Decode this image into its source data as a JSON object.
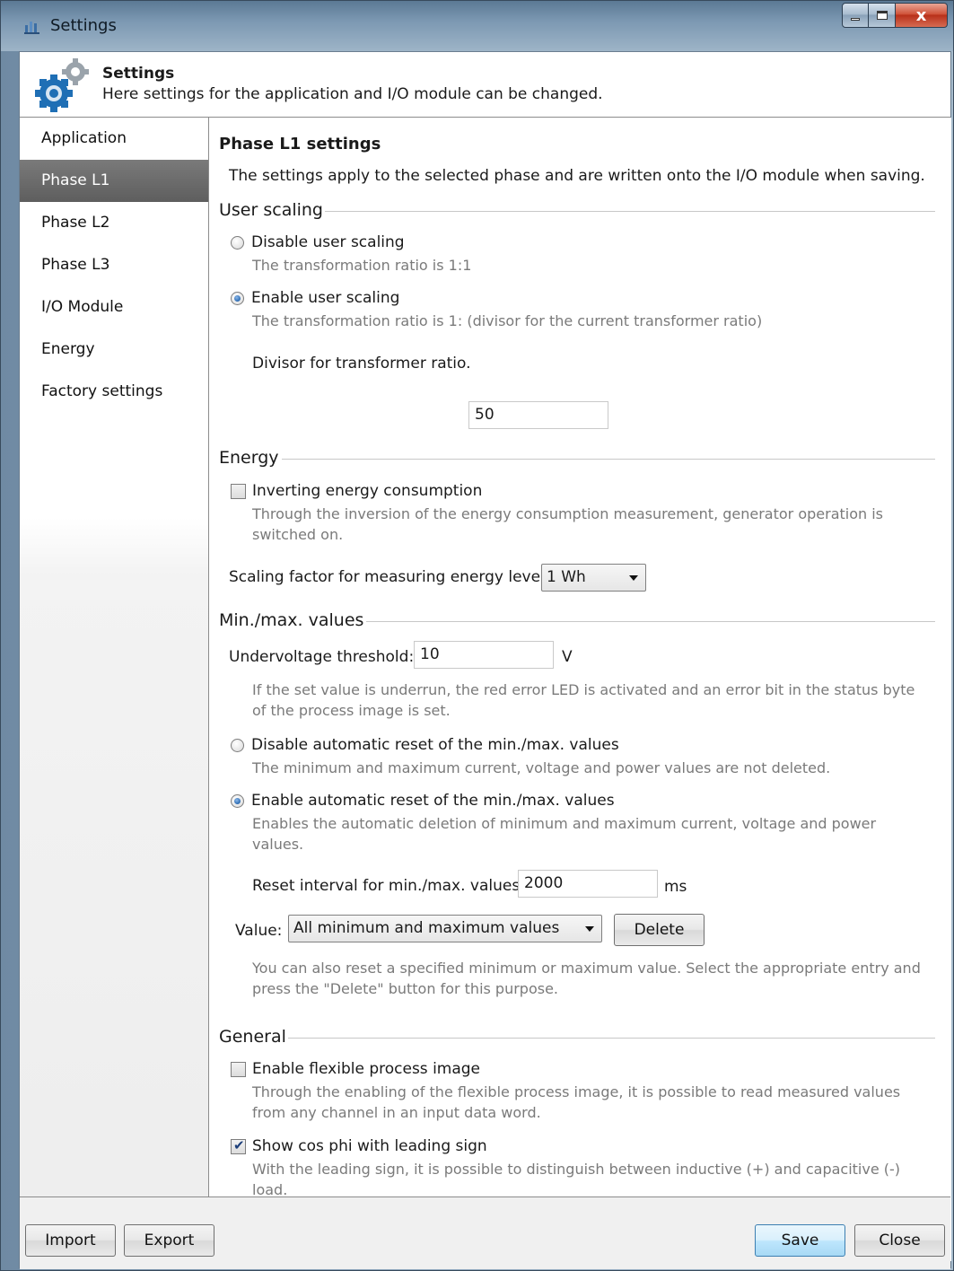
{
  "window": {
    "title": "Settings",
    "minimize_label": "",
    "maximize_label": "",
    "close_label": "x"
  },
  "header": {
    "title": "Settings",
    "subtitle": "Here settings for the application and I/O module can be changed."
  },
  "sidebar": {
    "items": [
      {
        "label": "Application"
      },
      {
        "label": "Phase L1",
        "selected": true
      },
      {
        "label": "Phase L2"
      },
      {
        "label": "Phase L3"
      },
      {
        "label": "I/O Module"
      },
      {
        "label": "Energy"
      },
      {
        "label": "Factory settings"
      }
    ]
  },
  "main": {
    "title": "Phase L1 settings",
    "intro": "The settings apply to the selected phase and are written onto the I/O module when saving.",
    "user_scaling": {
      "title": "User scaling",
      "disable_label": "Disable user scaling",
      "disable_desc": "The transformation ratio is 1:1",
      "disable_checked": false,
      "enable_label": "Enable user scaling",
      "enable_desc": "The transformation ratio is 1: (divisor for the current transformer ratio)",
      "enable_checked": true,
      "divisor_label": "Divisor for transformer ratio.",
      "divisor_value": "50"
    },
    "energy": {
      "title": "Energy",
      "invert_label": "Inverting energy consumption",
      "invert_checked": false,
      "invert_desc": "Through the inversion of the energy consumption measurement, generator operation is switched on.",
      "scaling_label": "Scaling factor for measuring energy level.",
      "scaling_value": "1 Wh"
    },
    "minmax": {
      "title": "Min./max. values",
      "undervoltage_label": "Undervoltage threshold:",
      "undervoltage_value": "10",
      "undervoltage_unit": "V",
      "undervoltage_desc": "If the set value is underrun, the red error LED is activated and an error bit in the status byte of the process image is set.",
      "disable_reset_label": "Disable automatic reset of the min./max. values",
      "disable_reset_desc": "The minimum and maximum current, voltage and power values are not deleted.",
      "disable_reset_checked": false,
      "enable_reset_label": "Enable automatic reset of the min./max. values",
      "enable_reset_desc": "Enables the automatic deletion of minimum and maximum current, voltage and power values.",
      "enable_reset_checked": true,
      "interval_label": "Reset interval for min./max. values:",
      "interval_value": "2000",
      "interval_unit": "ms",
      "value_label": "Value:",
      "value_selected": "All minimum and maximum values",
      "delete_label": "Delete",
      "reset_desc": "You can also reset a specified minimum or maximum value. Select the appropriate entry and press the \"Delete\" button for this purpose."
    },
    "general": {
      "title": "General",
      "flexible_label": "Enable flexible process image",
      "flexible_checked": false,
      "flexible_desc": "Through the enabling of the flexible process image, it is possible to read measured values from any channel in an input data word.",
      "cosphi_label": "Show cos phi with leading sign",
      "cosphi_checked": true,
      "cosphi_desc": "With the leading sign, it is possible to distinguish between inductive (+) and capacitive (-) load."
    }
  },
  "footer": {
    "import_label": "Import",
    "export_label": "Export",
    "save_label": "Save",
    "close_label": "Close"
  }
}
